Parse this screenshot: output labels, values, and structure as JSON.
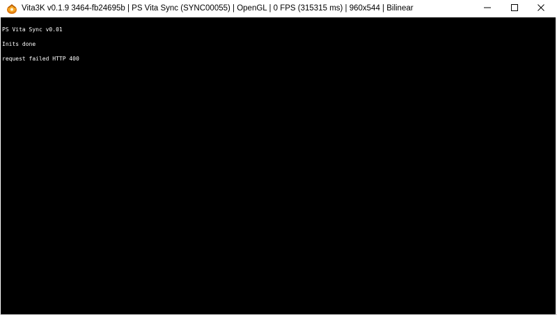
{
  "window": {
    "title": "Vita3K v0.1.9 3464-fb24695b | PS Vita Sync (SYNC00055) | OpenGL | 0 FPS (315315 ms) | 960x544 | Bilinear",
    "icon": "vita3k-app-icon",
    "controls": {
      "minimize": "minimize-icon",
      "maximize": "maximize-icon",
      "close": "close-icon"
    }
  },
  "console": {
    "lines": [
      "PS Vita Sync v0.01",
      "Inits done",
      "request failed HTTP 400"
    ]
  },
  "colors": {
    "viewport_background": "#000000",
    "console_text": "#ffffff",
    "titlebar_background": "#ffffff"
  }
}
